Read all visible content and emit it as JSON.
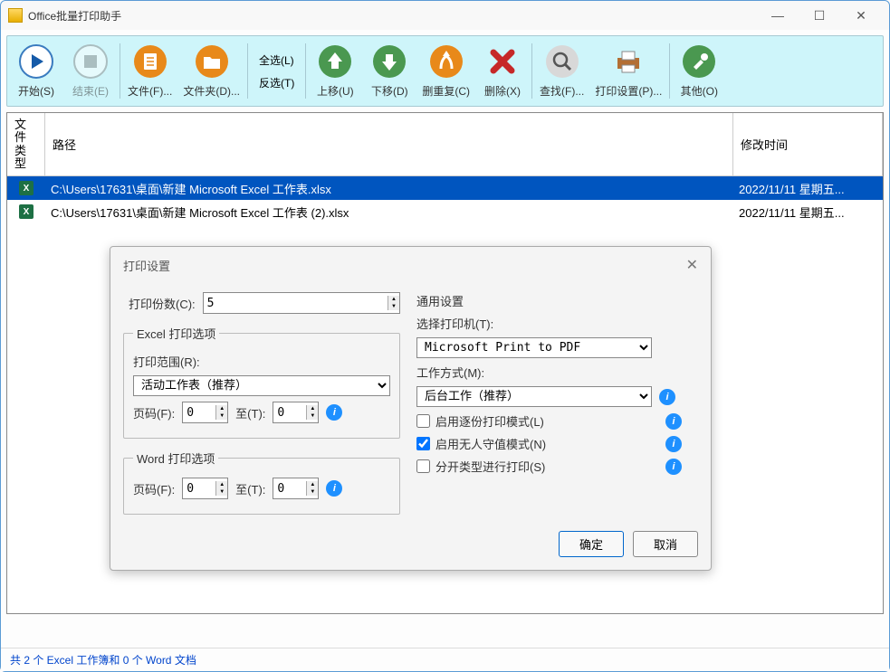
{
  "window": {
    "title": "Office批量打印助手"
  },
  "toolbar": {
    "start": "开始(S)",
    "end": "结束(E)",
    "file": "文件(F)...",
    "folder": "文件夹(D)...",
    "select_all": "全选(L)",
    "invert": "反选(T)",
    "move_up": "上移(U)",
    "move_down": "下移(D)",
    "dedupe": "删重复(C)",
    "delete": "删除(X)",
    "find": "查找(F)...",
    "print_settings": "打印设置(P)...",
    "other": "其他(O)"
  },
  "table": {
    "headers": {
      "type": "文件类型",
      "path": "路径",
      "time": "修改时间"
    },
    "rows": [
      {
        "path": "C:\\Users\\17631\\桌面\\新建 Microsoft Excel 工作表.xlsx",
        "time": "2022/11/11 星期五...",
        "selected": true
      },
      {
        "path": "C:\\Users\\17631\\桌面\\新建 Microsoft Excel 工作表 (2).xlsx",
        "time": "2022/11/11 星期五...",
        "selected": false
      }
    ]
  },
  "status": "共 2 个 Excel 工作簿和 0 个 Word 文档",
  "dialog": {
    "title": "打印设置",
    "copies_label": "打印份数(C):",
    "copies_value": "5",
    "excel_legend": "Excel 打印选项",
    "range_label": "打印范围(R):",
    "range_value": "活动工作表（推荐）",
    "page_from_label": "页码(F):",
    "page_from_value": "0",
    "page_to_label": "至(T):",
    "page_to_value": "0",
    "word_legend": "Word 打印选项",
    "word_from_label": "页码(F):",
    "word_from_value": "0",
    "word_to_label": "至(T):",
    "word_to_value": "0",
    "general_title": "通用设置",
    "printer_label": "选择打印机(T):",
    "printer_value": "Microsoft Print to PDF",
    "mode_label": "工作方式(M):",
    "mode_value": "后台工作（推荐）",
    "chk1": "启用逐份打印模式(L)",
    "chk2": "启用无人守值模式(N)",
    "chk3": "分开类型进行打印(S)",
    "ok": "确定",
    "cancel": "取消"
  }
}
